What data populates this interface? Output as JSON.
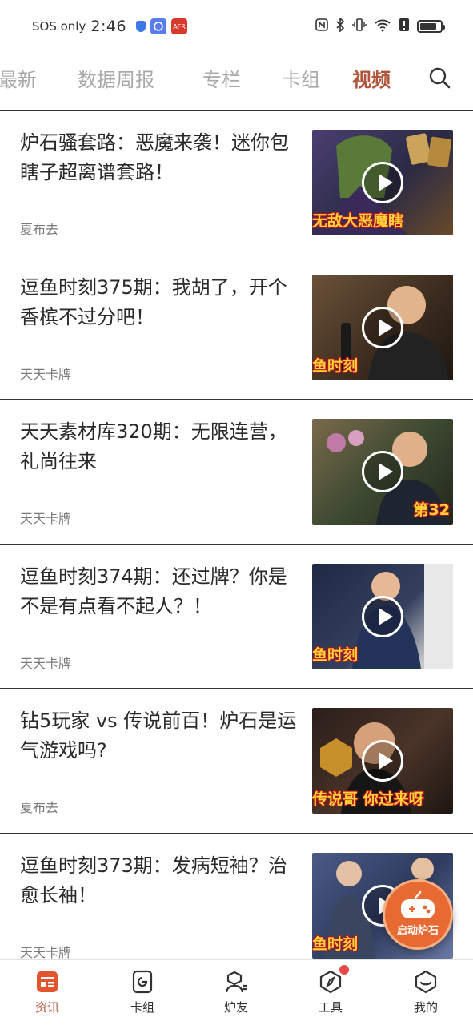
{
  "status_bar": {
    "carrier": "SOS only",
    "time": "2:46",
    "app_badge_red": "AFR",
    "battery_level": 0.85
  },
  "tabs": [
    {
      "label": "最新",
      "active": false
    },
    {
      "label": "数据周报",
      "active": false
    },
    {
      "label": "专栏",
      "active": false
    },
    {
      "label": "卡组",
      "active": false
    },
    {
      "label": "视频",
      "active": true
    }
  ],
  "colors": {
    "accent": "#b0553a",
    "tab_inactive": "#a8a8a8",
    "fab": "#e86a33",
    "notification_dot": "#e84a4a"
  },
  "articles": [
    {
      "title": "炉石骚套路：恶魔来袭！迷你包瞎子超离谱套路！",
      "source": "夏布去",
      "thumb_caption": "无敌大恶魔瞎",
      "thumb_bg": "#3a2e5a"
    },
    {
      "title": "逗鱼时刻375期：我胡了，开个香槟不过分吧！",
      "source": "天天卡牌",
      "thumb_caption": "鱼时刻",
      "thumb_bg": "#4a3a2a"
    },
    {
      "title": "天天素材库320期：无限连营，礼尚往来",
      "source": "天天卡牌",
      "thumb_caption": "第32",
      "thumb_bg": "#2f3a2a"
    },
    {
      "title": "逗鱼时刻374期：还过牌？你是不是有点看不起人？！",
      "source": "天天卡牌",
      "thumb_caption": "鱼时刻",
      "thumb_bg": "#2a3550"
    },
    {
      "title": "钻5玩家 vs 传说前百！炉石是运气游戏吗?",
      "source": "夏布去",
      "thumb_caption": "传说哥 你过来呀",
      "thumb_bg": "#3a2a22"
    },
    {
      "title": "逗鱼时刻373期：发病短袖？治愈长袖！",
      "source": "天天卡牌",
      "thumb_caption": "鱼时刻",
      "thumb_bg": "#3a4a6a"
    }
  ],
  "fab": {
    "label": "启动炉石"
  },
  "bottom_nav": [
    {
      "label": "资讯",
      "icon": "news-icon",
      "active": true
    },
    {
      "label": "卡组",
      "icon": "deck-icon",
      "active": false
    },
    {
      "label": "炉友",
      "icon": "friends-icon",
      "active": false
    },
    {
      "label": "工具",
      "icon": "tools-icon",
      "active": false,
      "badge": true
    },
    {
      "label": "我的",
      "icon": "profile-icon",
      "active": false
    }
  ]
}
